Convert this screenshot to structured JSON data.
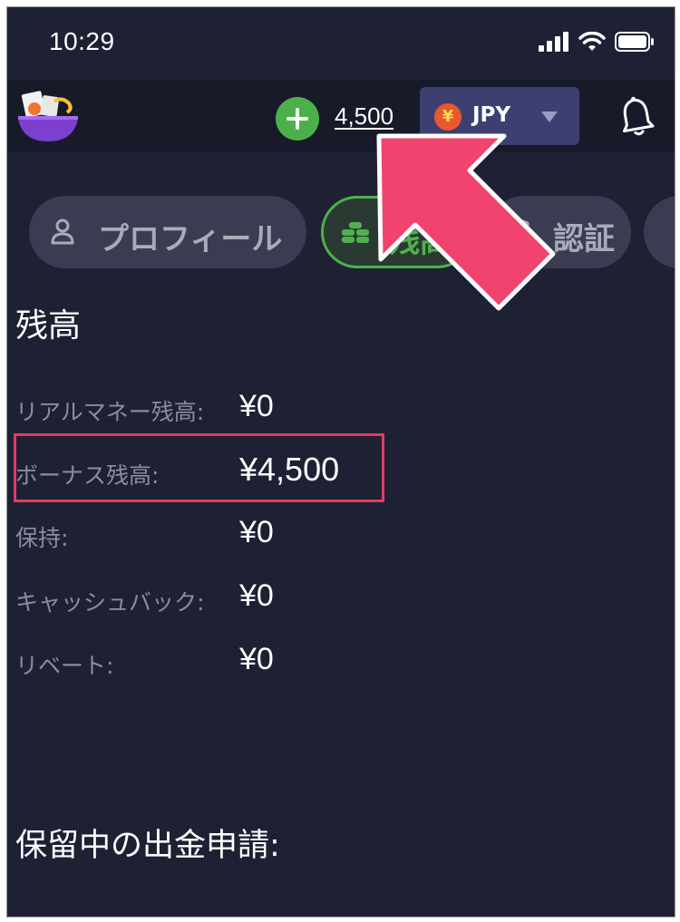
{
  "status_bar": {
    "time": "10:29"
  },
  "header": {
    "balance": "4,500",
    "currency": {
      "symbol": "¥",
      "code": "JPY"
    }
  },
  "tabs": [
    {
      "label": "プロフィール",
      "icon": "user-icon",
      "active": false
    },
    {
      "label": "残高",
      "icon": "coins-icon",
      "active": true
    },
    {
      "label": "認証",
      "icon": "shield-icon",
      "active": false
    }
  ],
  "balance_section": {
    "title": "残高",
    "rows": [
      {
        "label": "リアルマネー残高:",
        "value": "¥0"
      },
      {
        "label": "ボーナス残高:",
        "value": "¥4,500"
      },
      {
        "label": "保持:",
        "value": "¥0"
      },
      {
        "label": "キャッシュバック:",
        "value": "¥0"
      },
      {
        "label": "リベート:",
        "value": "¥0"
      }
    ]
  },
  "pending_withdrawals": {
    "title": "保留中の出金申請:"
  },
  "colors": {
    "background": "#1e2133",
    "header": "#171a29",
    "accent_green": "#4fb14c",
    "currency_button": "#3e3f71",
    "annotation_pink": "#e23c62"
  }
}
